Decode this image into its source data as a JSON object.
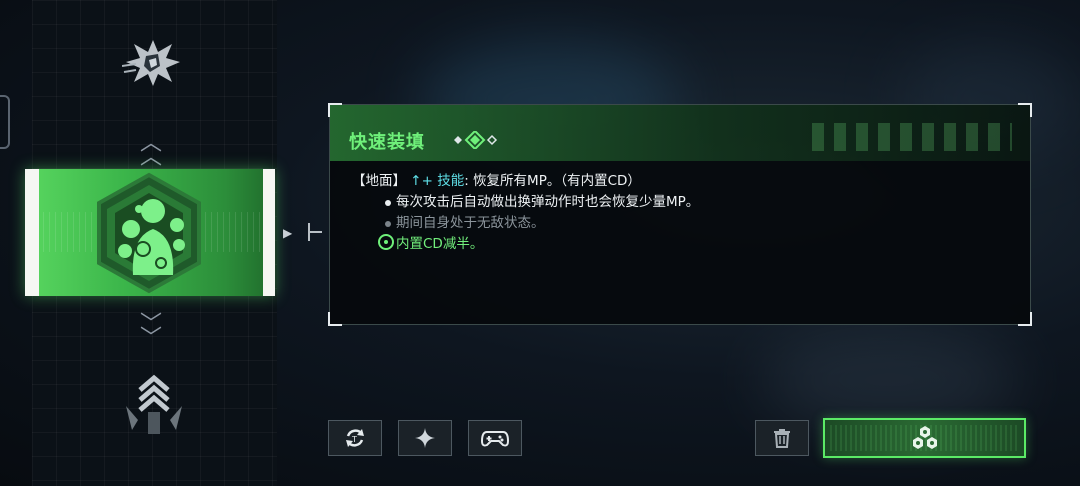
{
  "colors": {
    "accent_green": "#6ff07a",
    "skill_highlight": "#5fe0e8",
    "panel_bg": "#05090c",
    "card_green": "#3bb54a"
  },
  "skill_list": {
    "selected_card_icon": "skill-burst-icon",
    "top_icon": "spark-burst-icon",
    "bottom_icon": "rank-chevron-icon"
  },
  "detail": {
    "title": "快速装填",
    "line1": {
      "prefix": "【地面】",
      "input": "↑+ 技能",
      "suffix": ": 恢复所有MP。（有内置CD）"
    },
    "bullets": [
      {
        "text": "每次攻击后自动做出换弹动作时也会恢复少量MP。",
        "state": "active"
      },
      {
        "text": "期间自身处于无敌状态。",
        "state": "inactive"
      },
      {
        "text": "内置CD减半。",
        "state": "selected"
      }
    ]
  },
  "toolbar": {
    "buttons": [
      {
        "icon": "refresh-icon"
      },
      {
        "icon": "sparkle-icon"
      },
      {
        "icon": "gamepad-icon"
      }
    ],
    "delete_icon": "trash-icon",
    "confirm_icon": "equip-cluster-icon"
  }
}
